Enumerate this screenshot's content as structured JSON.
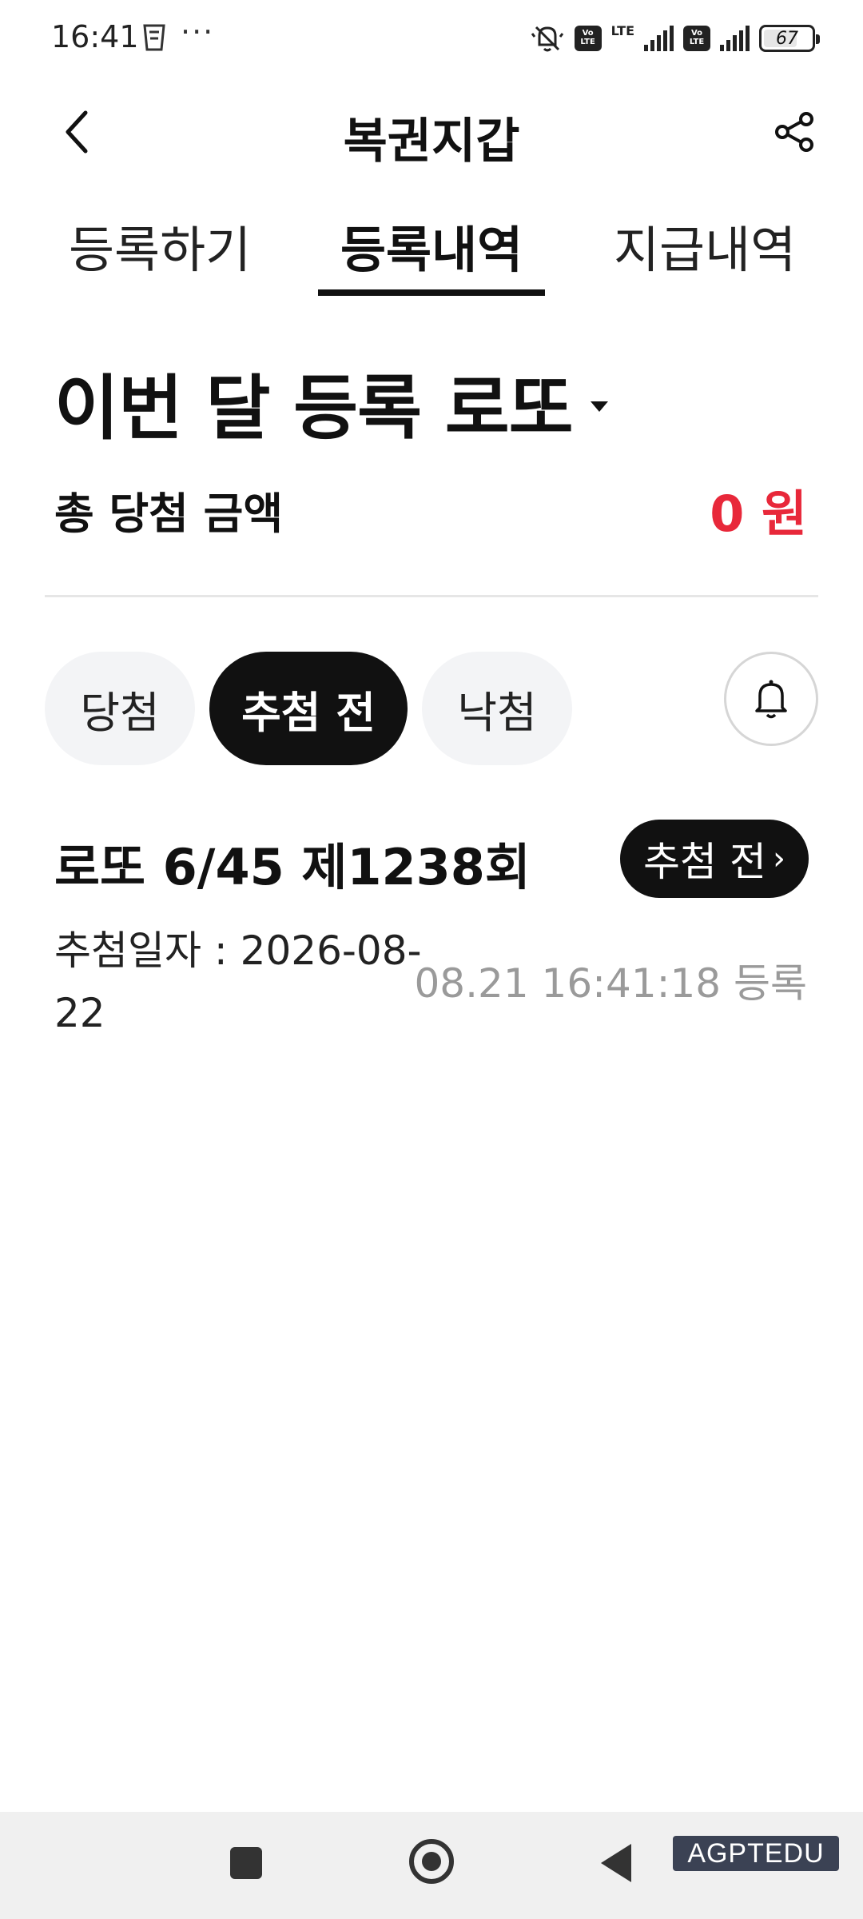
{
  "status_bar": {
    "time": "16:41",
    "more": "···",
    "lte_label": "LTE",
    "volte_label": "Vo LTE",
    "battery": "67"
  },
  "header": {
    "title": "복권지갑"
  },
  "tabs": [
    {
      "label": "등록하기",
      "selected": false
    },
    {
      "label": "등록내역",
      "selected": true
    },
    {
      "label": "지급내역",
      "selected": false
    }
  ],
  "month": {
    "title": "이번 달 등록 로또",
    "total_label": "총 당첨 금액",
    "total_amount": "0 원"
  },
  "filters": [
    {
      "label": "당첨",
      "selected": false
    },
    {
      "label": "추첨 전",
      "selected": true
    },
    {
      "label": "낙첨",
      "selected": false
    }
  ],
  "entry": {
    "title": "로또 6/45 제1238회",
    "status": "추첨 전",
    "draw_date": "추첨일자 : 2026-08-22",
    "registered_at": "08.21 16:41:18 등록"
  },
  "watermark": "AGPTEDU",
  "colors": {
    "accent_red": "#e8283a",
    "dark": "#111111",
    "chip_bg": "#f3f4f6"
  },
  "icons": {
    "back": "chevron-left-icon",
    "share": "share-icon",
    "bell": "bell-icon"
  }
}
